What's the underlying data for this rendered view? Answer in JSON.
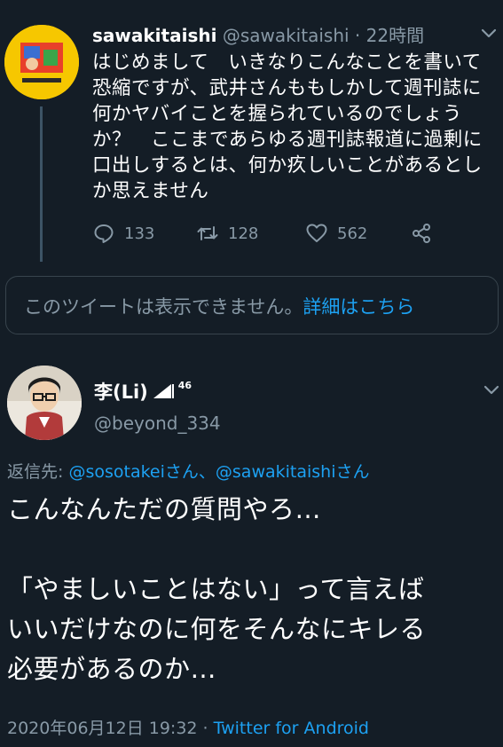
{
  "tweet1": {
    "name": "sawakitaishi",
    "handle": "@sawakitaishi",
    "separator": " · ",
    "time": "22時間",
    "lines": [
      "はじめまして　いきなりこんなことを書いて",
      "恐縮ですが、武井さんももしかして週刊誌に",
      "何かヤバイことを握られているのでしょう",
      "か？　ここまであらゆる週刊誌報道に過剰に",
      "口出しするとは、何か疚しいことがあるとし",
      "か思えません"
    ],
    "replies": "133",
    "retweets": "128",
    "likes": "562",
    "icons": {
      "reply": "reply-icon",
      "retweet": "retweet-icon",
      "like": "heart-icon",
      "share": "share-icon",
      "more": "chevron-down-icon"
    }
  },
  "unavailable": {
    "text": "このツイートは表示できません。",
    "link": "詳細はこちら"
  },
  "tweet2": {
    "name": "李(Li)",
    "name_badge": "46",
    "handle": "@beyond_334",
    "reply_label": "返信先: ",
    "reply_user1": "@sosotakeiさん",
    "reply_sep": "、",
    "reply_user2": "@sawakitaishiさん",
    "lines": [
      "こんなんただの質問やろ…",
      "",
      "「やましいことはない」って言えば",
      "いいだけなのに何をそんなにキレる",
      "必要があるのか…"
    ],
    "date": "2020年06月12日 19:32",
    "meta_sep": " · ",
    "source": "Twitter for Android"
  },
  "colors": {
    "background": "#141d26",
    "muted": "#8899a6",
    "link": "#1da1f2",
    "border": "#38444d"
  }
}
